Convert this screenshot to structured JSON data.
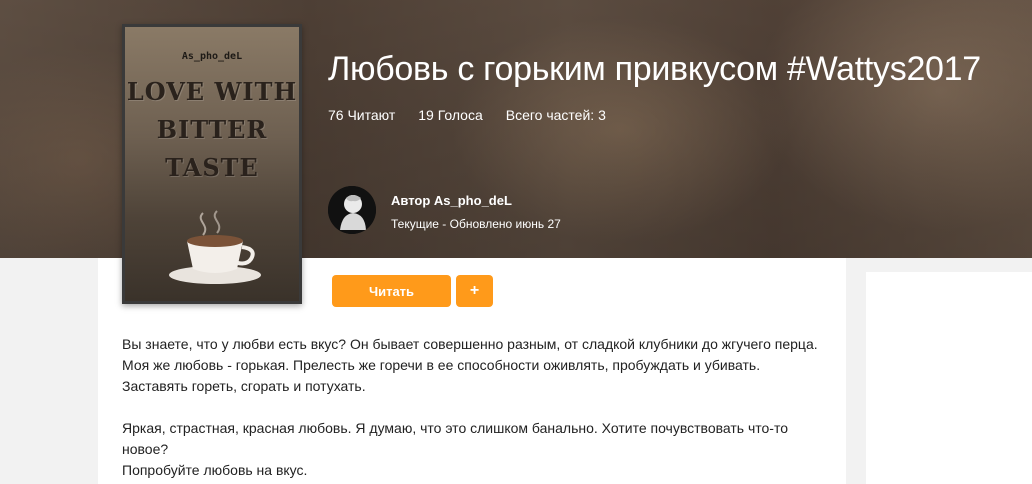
{
  "story": {
    "title": "Любовь с горьким привкусом #Wattys2017",
    "stats": {
      "reads": "76 Читают",
      "votes": "19 Голоса",
      "parts": "Всего частей: 3"
    },
    "cover": {
      "author": "As_pho_deL",
      "title_lines": [
        "LOVE WITH",
        "BITTER",
        "TASTE"
      ]
    },
    "author_line": "Автор As_pho_deL",
    "status_line": "Текущие - Обновлено июнь 27",
    "read_button": "Читать",
    "add_button": "+",
    "description": {
      "paragraph1": "Вы знаете, что у любви есть вкус? Он бывает совершенно разным, от сладкой клубники до жгучего перца. Моя же любовь - горькая. Прелесть же горечи в ее способности оживлять, пробуждать и убивать. Заставять гореть, сгорать и потухать.",
      "paragraph2_line1": "Яркая, страстная, красная любовь. Я думаю, что это слишком банально. Хотите почувствовать что-то новое?",
      "paragraph2_line2": "Попробуйте любовь на вкус."
    }
  },
  "colors": {
    "accent": "#ff9a1a",
    "hero_text": "#ffffff",
    "body_text": "#222222"
  }
}
